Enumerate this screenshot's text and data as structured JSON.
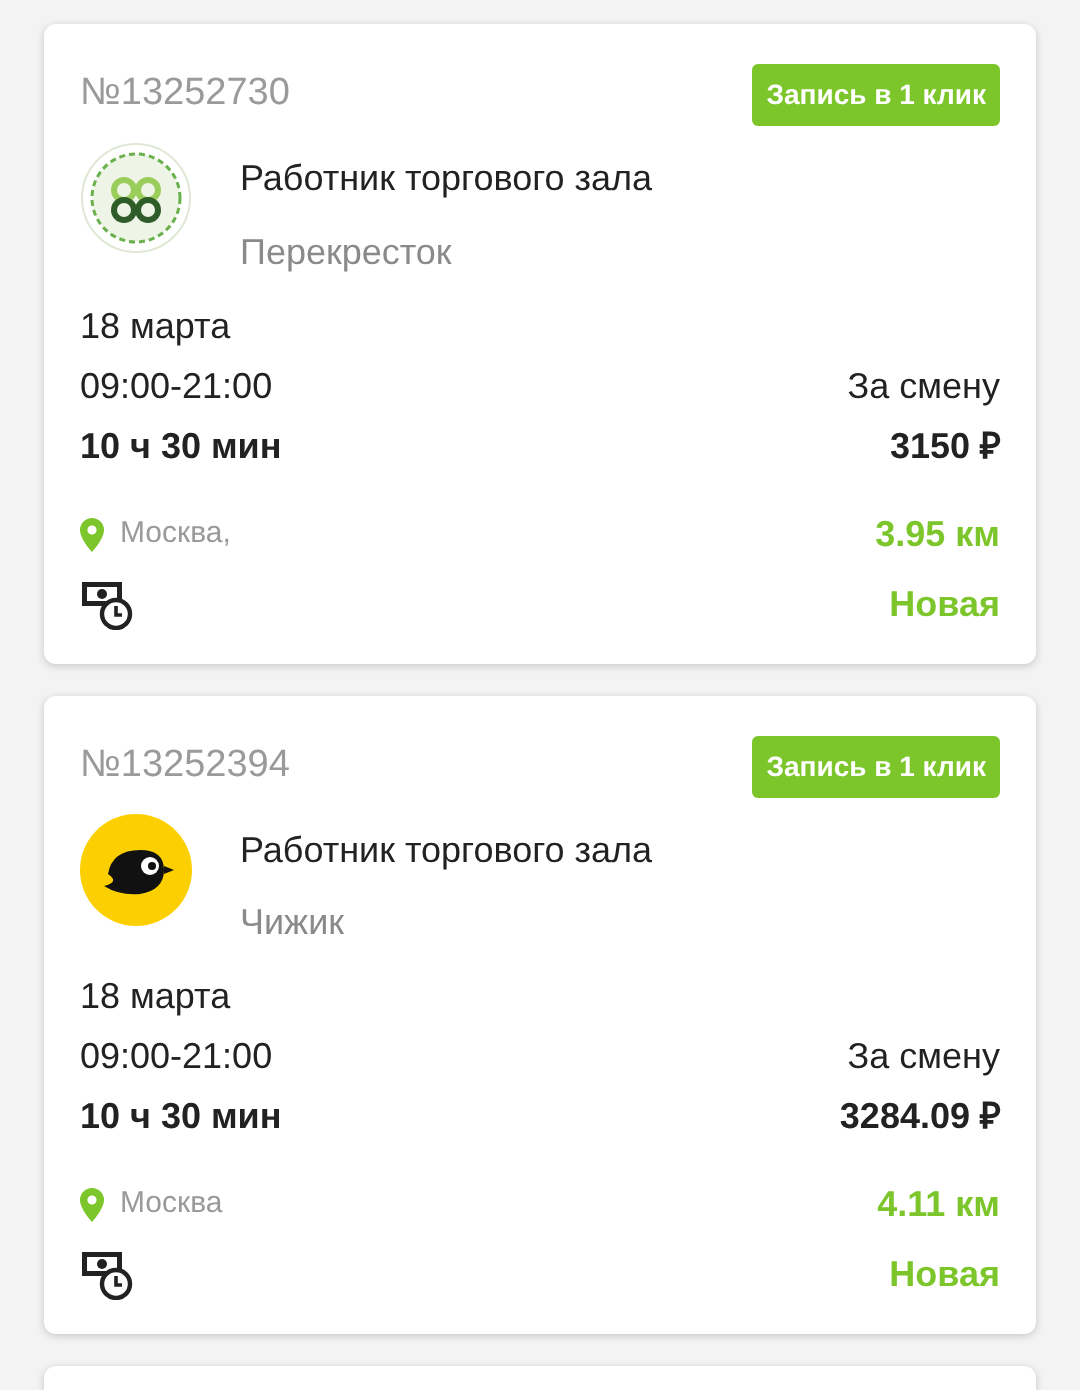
{
  "cards": [
    {
      "number": "№13252730",
      "badge": "Запись в 1 клик",
      "logo": {
        "kind": "perekrestok"
      },
      "title": "Работник торгового зала",
      "company": "Перекресток",
      "date": "18 марта",
      "time": "09:00-21:00",
      "duration": "10 ч 30 мин",
      "pay_label": "За смену",
      "pay": "3150 ₽",
      "city": "Москва,",
      "distance": "3.95 км",
      "status": "Новая"
    },
    {
      "number": "№13252394",
      "badge": "Запись в 1 клик",
      "logo": {
        "kind": "chizhik"
      },
      "title": "Работник торгового зала",
      "company": "Чижик",
      "date": "18 марта",
      "time": "09:00-21:00",
      "duration": "10 ч 30 мин",
      "pay_label": "За смену",
      "pay": "3284.09 ₽",
      "city": "Москва",
      "distance": "4.11 км",
      "status": "Новая"
    }
  ]
}
